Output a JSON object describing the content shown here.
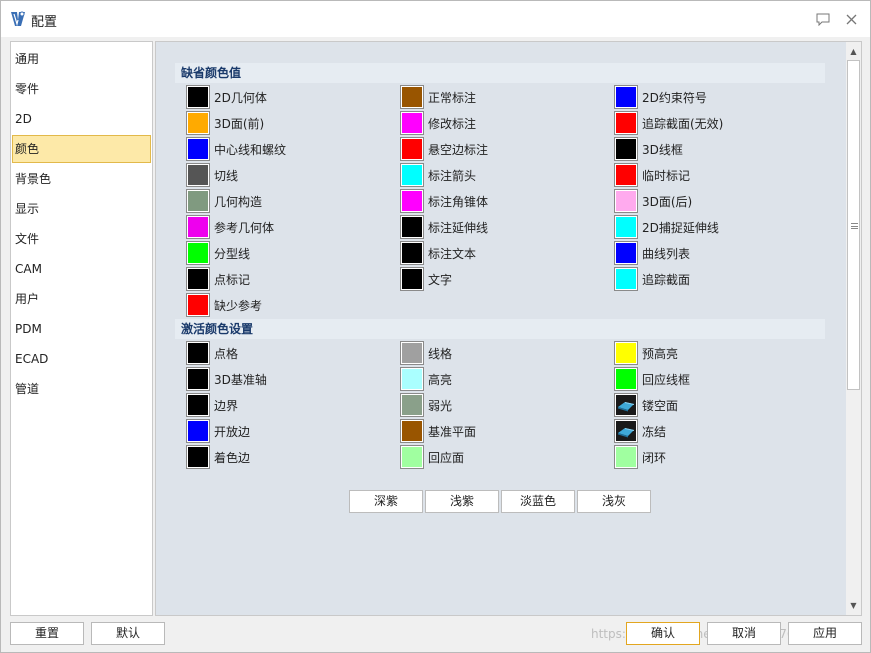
{
  "window": {
    "title": "配置"
  },
  "sidebar": {
    "items": [
      {
        "label": "通用"
      },
      {
        "label": "零件"
      },
      {
        "label": "2D"
      },
      {
        "label": "颜色",
        "selected": true
      },
      {
        "label": "背景色"
      },
      {
        "label": "显示"
      },
      {
        "label": "文件"
      },
      {
        "label": "CAM"
      },
      {
        "label": "用户"
      },
      {
        "label": "PDM"
      },
      {
        "label": "ECAD"
      },
      {
        "label": "管道"
      }
    ]
  },
  "sections": {
    "default": {
      "title": "缺省颜色值"
    },
    "active": {
      "title": "激活颜色设置"
    }
  },
  "default_colors": {
    "col1": [
      {
        "label": "2D几何体",
        "color": "#000000"
      },
      {
        "label": "3D面(前)",
        "color": "#ffaa00"
      },
      {
        "label": "中心线和螺纹",
        "color": "#0000ff"
      },
      {
        "label": "切线",
        "color": "#555555"
      },
      {
        "label": "几何构造",
        "color": "#809a80"
      },
      {
        "label": "参考几何体",
        "color": "#ee00ee"
      },
      {
        "label": "分型线",
        "color": "#00ff00"
      },
      {
        "label": "点标记",
        "color": "#000000"
      },
      {
        "label": "缺少参考",
        "color": "#ff0000"
      }
    ],
    "col2": [
      {
        "label": "正常标注",
        "color": "#995500"
      },
      {
        "label": "修改标注",
        "color": "#ff00ff"
      },
      {
        "label": "悬空边标注",
        "color": "#ff0000"
      },
      {
        "label": "标注箭头",
        "color": "#00ffff"
      },
      {
        "label": "标注角锥体",
        "color": "#ff00ff"
      },
      {
        "label": "标注延伸线",
        "color": "#000000"
      },
      {
        "label": "标注文本",
        "color": "#000000"
      },
      {
        "label": "文字",
        "color": "#000000"
      }
    ],
    "col3": [
      {
        "label": "2D约束符号",
        "color": "#0000ff"
      },
      {
        "label": "追踪截面(无效)",
        "color": "#ff0000"
      },
      {
        "label": "3D线框",
        "color": "#000000"
      },
      {
        "label": "临时标记",
        "color": "#ff0000"
      },
      {
        "label": "3D面(后)",
        "color": "#ffaaee"
      },
      {
        "label": "2D捕捉延伸线",
        "color": "#00ffff"
      },
      {
        "label": "曲线列表",
        "color": "#0000ff"
      },
      {
        "label": "追踪截面",
        "color": "#00ffff"
      }
    ]
  },
  "active_colors": {
    "col1": [
      {
        "label": "点格",
        "color": "#000000"
      },
      {
        "label": "3D基准轴",
        "color": "#000000"
      },
      {
        "label": "边界",
        "color": "#000000"
      },
      {
        "label": "开放边",
        "color": "#0000ff"
      },
      {
        "label": "着色边",
        "color": "#000000"
      }
    ],
    "col2": [
      {
        "label": "线格",
        "color": "#a0a0a0"
      },
      {
        "label": "高亮",
        "color": "#aaffff"
      },
      {
        "label": "弱光",
        "color": "#8aa08a"
      },
      {
        "label": "基准平面",
        "color": "#995500"
      },
      {
        "label": "回应面",
        "color": "#a0ffa0"
      }
    ],
    "col3": [
      {
        "label": "预高亮",
        "color": "#ffff00"
      },
      {
        "label": "回应线框",
        "color": "#00ff00"
      },
      {
        "label": "镂空面",
        "color": "#1a1a1a",
        "icon": "shaded-solid-icon"
      },
      {
        "label": "冻结",
        "color": "#1a1a1a",
        "icon": "shaded-solid-icon"
      },
      {
        "label": "闭环",
        "color": "#a0ffa0"
      }
    ]
  },
  "presets": [
    {
      "label": "深紫"
    },
    {
      "label": "浅紫"
    },
    {
      "label": "淡蓝色"
    },
    {
      "label": "浅灰"
    }
  ],
  "footer": {
    "reset_label": "重置",
    "default_label": "默认",
    "ok_label": "确认",
    "cancel_label": "取消",
    "apply_label": "应用",
    "watermark": "https://blog.csdn.net/weixin_43769798"
  },
  "accent_colors": {
    "selected_bg": "#fde9a8",
    "section_title": "#1a3a6b",
    "primary_border": "#e2a620"
  }
}
